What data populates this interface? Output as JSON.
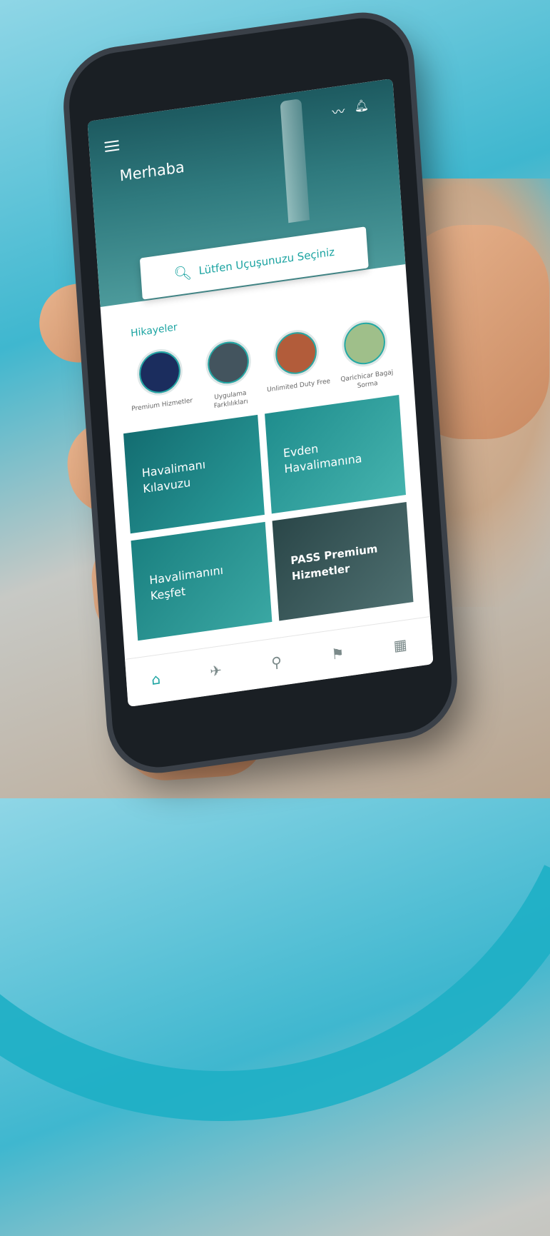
{
  "app": {
    "greeting": "Merhaba",
    "flight_select": "Lütfen Uçuşunuzu Seçiniz"
  },
  "stories": {
    "title": "Hikayeler",
    "items": [
      {
        "label": "Premium Hizmetler"
      },
      {
        "label": "Uygulama Farklılıkları"
      },
      {
        "label": "Unlimited Duty Free"
      },
      {
        "label": "Qarichicar Bagaj Sorma"
      }
    ]
  },
  "tiles": [
    {
      "label": "Havalimanı Kılavuzu"
    },
    {
      "label": "Evden Havalimanına"
    },
    {
      "label": "Havalimanını Keşfet"
    },
    {
      "label": "PASS Premium Hizmetler"
    }
  ],
  "nav": {
    "items": [
      {
        "icon": "home-icon"
      },
      {
        "icon": "flight-icon"
      },
      {
        "icon": "location-pin-icon"
      },
      {
        "icon": "signpost-icon"
      },
      {
        "icon": "qr-code-icon"
      }
    ]
  },
  "colors": {
    "accent": "#1aa3a1",
    "hero": "#2f7a7e"
  }
}
